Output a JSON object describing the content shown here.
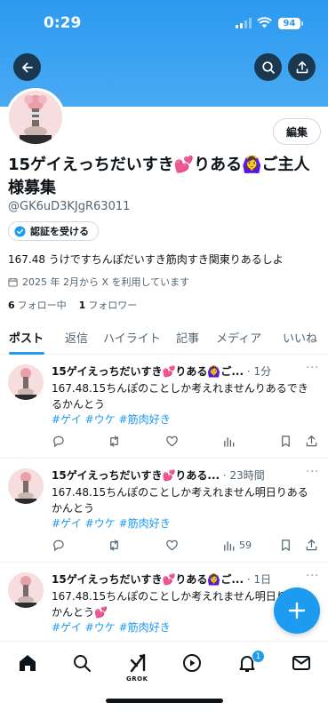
{
  "status_bar": {
    "time": "0:29",
    "battery": "94"
  },
  "profile": {
    "display_name": "15ゲイえっちだいすき💕りある🙆‍♀️ご主人様募集",
    "handle": "@GK6uD3KJgR63011",
    "edit_label": "編集",
    "verify_label": "認証を受ける",
    "bio": "167.48 うけですちんぽだいすき筋肉すき関東りあるしよ",
    "joined": "2025 年 2月から X を利用しています",
    "following_count": "6",
    "following_label": "フォロー中",
    "followers_count": "1",
    "followers_label": "フォロワー"
  },
  "tabs": [
    "ポスト",
    "返信",
    "ハイライト",
    "記事",
    "メディア",
    "いいね"
  ],
  "posts": [
    {
      "name": "15ゲイえっちだいすき💕りある🙆‍♀️ご...",
      "time": "1分",
      "body": "167.48.15ちんぽのことしか考えれませんりあるできるかんとう",
      "tags": [
        "#ゲイ",
        "#ウケ",
        "#筋肉好き"
      ],
      "views": ""
    },
    {
      "name": "15ゲイえっちだいすき💕りある...",
      "time": "23時間",
      "body": "167.48.15ちんぽのことしか考えれません明日りあるかんとう",
      "tags": [
        "#ゲイ",
        "#ウケ",
        "#筋肉好き"
      ],
      "views": "59"
    },
    {
      "name": "15ゲイえっちだいすき💕りある🙆‍♀️ご...",
      "time": "1日",
      "body": "167.48.15ちんぽのことしか考えれません明日りあるかんとう💕",
      "tags": [
        "#ゲイ",
        "#ウケ",
        "#筋肉好き"
      ],
      "views": ""
    }
  ],
  "nav": {
    "grok_label": "GROK",
    "notification_count": "1"
  },
  "colors": {
    "accent": "#1d9bf0",
    "banner": "#2b9af0",
    "text": "#0f1419",
    "muted": "#536471"
  },
  "icons": [
    "back-arrow-icon",
    "search-icon",
    "share-icon",
    "verified-badge-icon",
    "calendar-icon",
    "reply-icon",
    "repost-icon",
    "like-icon",
    "views-icon",
    "bookmark-icon",
    "compose-plus-icon",
    "home-icon",
    "grok-icon",
    "play-icon",
    "bell-icon",
    "mail-icon"
  ]
}
